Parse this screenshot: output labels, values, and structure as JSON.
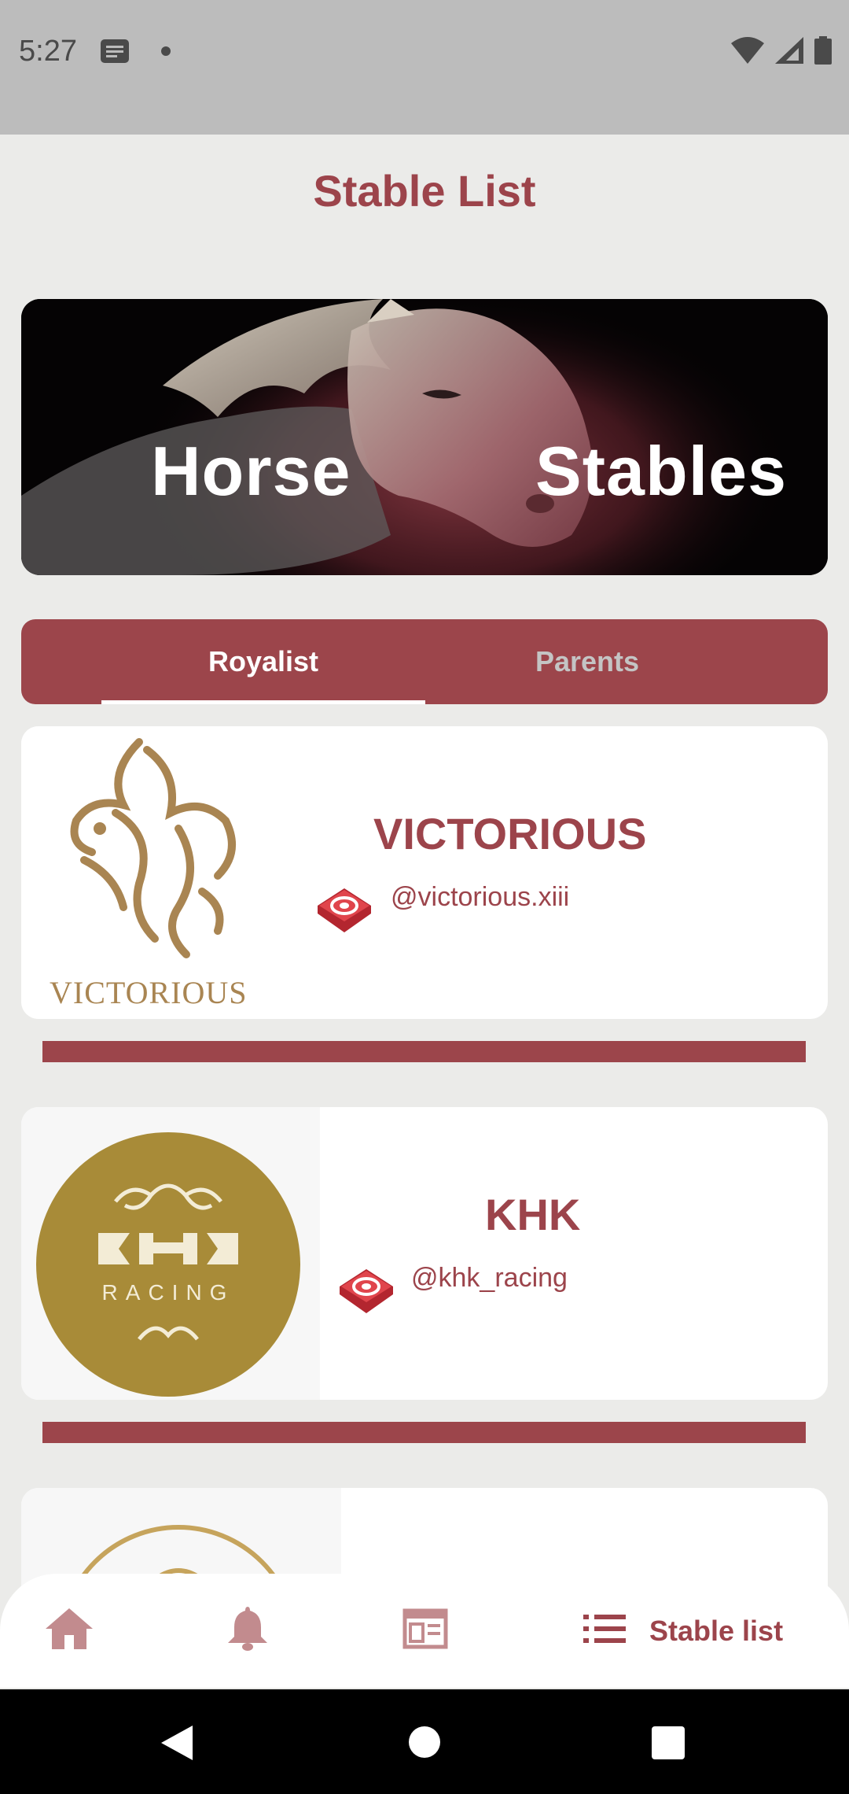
{
  "status_bar": {
    "time": "5:27",
    "left_icons": [
      "notification-text-icon",
      "dot-icon"
    ],
    "right_icons": [
      "wifi-icon",
      "cell-signal-icon",
      "battery-icon"
    ]
  },
  "header": {
    "title": "Stable List"
  },
  "hero": {
    "word_left": "Horse",
    "word_right": "Stables"
  },
  "tabs": [
    {
      "label": "Royalist",
      "active": true
    },
    {
      "label": "Parents",
      "active": false
    }
  ],
  "stables": [
    {
      "name": "VICTORIOUS",
      "handle": "@victorious.xiii",
      "logo_text": "VICTORIOUS",
      "social_icon": "social-app-icon"
    },
    {
      "name": "KHK",
      "handle": "@khk_racing",
      "logo_text": "RACING",
      "social_icon": "social-app-icon"
    },
    {
      "name": "",
      "handle": "",
      "social_icon": ""
    }
  ],
  "bottom_nav": {
    "items": [
      {
        "icon": "home-icon",
        "label": ""
      },
      {
        "icon": "bell-icon",
        "label": ""
      },
      {
        "icon": "news-icon",
        "label": ""
      },
      {
        "icon": "list-icon",
        "label": "Stable list",
        "active": true
      }
    ]
  },
  "system_nav": [
    "back-icon",
    "home-circle-icon",
    "recents-icon"
  ],
  "colors": {
    "accent": "#9c444b",
    "background": "#ebebe9",
    "gold": "#a88b38",
    "logo_brown": "#a98552"
  }
}
